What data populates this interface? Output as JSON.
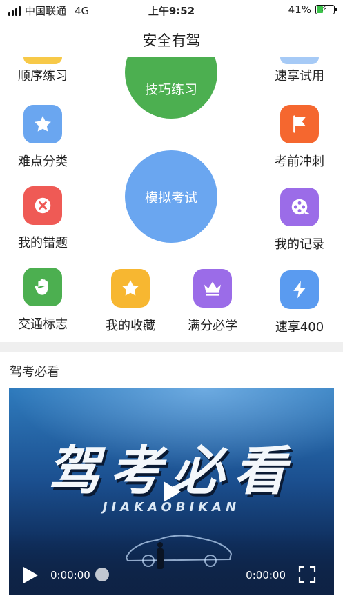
{
  "status": {
    "carrier": "中国联通",
    "network": "4G",
    "time": "上午9:52",
    "battery": "41%",
    "battery_level": 0.41
  },
  "nav": {
    "title": "安全有驾"
  },
  "grid": {
    "sequential_practice": "顺序练习",
    "skill_practice": "技巧练习",
    "quick_trial": "速享试用",
    "difficult_categories": "难点分类",
    "mock_exam": "模拟考试",
    "pre_exam_sprint": "考前冲刺",
    "my_mistakes": "我的错题",
    "my_records": "我的记录",
    "traffic_signs": "交通标志",
    "my_favorites": "我的收藏",
    "full_score_must_learn": "满分必学",
    "quick_400": "速享400"
  },
  "section": {
    "title": "驾考必看"
  },
  "video": {
    "title_text": "驾考必看",
    "subtitle_text": "JIAKAOBIKAN",
    "current_time": "0:00:00",
    "duration": "0:00:00"
  },
  "colors": {
    "green": "#4caf50",
    "blue": "#6aa6f0",
    "orange": "#f5672f",
    "red": "#ef5a55",
    "purple": "#9b6ce8",
    "yellow": "#f7b731"
  }
}
